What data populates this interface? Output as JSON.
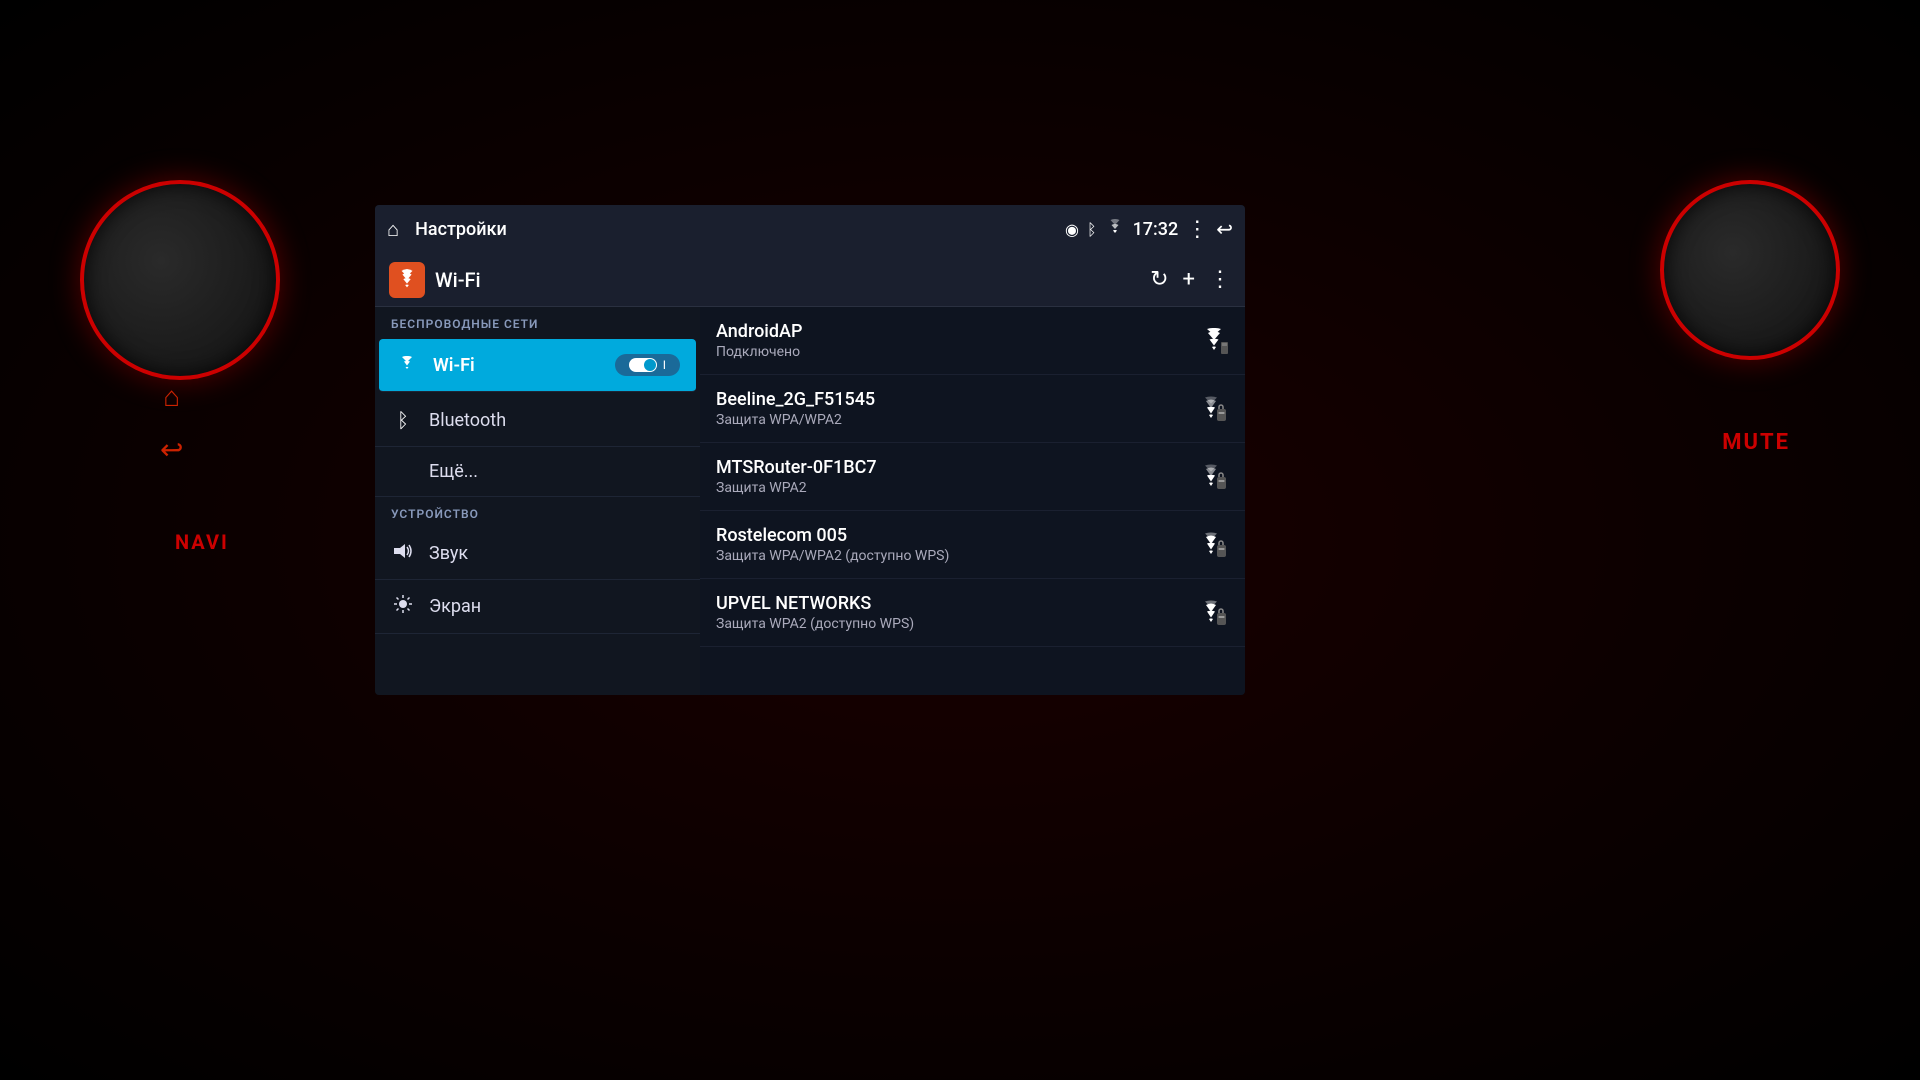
{
  "dashboard": {
    "mute_label": "MUTE",
    "navi_label": "NAVI"
  },
  "statusbar": {
    "title": "Настройки",
    "time": "17:32",
    "home_icon": "⌂",
    "back_icon": "↩",
    "more_icon": "⋮",
    "location_icon": "◉",
    "bluetooth_icon": "ᛒ",
    "wifi_icon": "▲"
  },
  "wifi_header": {
    "label": "Wi-Fi",
    "icon": "✕",
    "refresh_icon": "↻",
    "add_icon": "+",
    "more_icon": "⋮"
  },
  "sidebar": {
    "wireless_section": "БЕСПРОВОДНЫЕ СЕТИ",
    "device_section": "УСТРОЙСТВО",
    "items": [
      {
        "id": "wifi",
        "label": "Wi-Fi",
        "icon": "▲",
        "active": true
      },
      {
        "id": "bluetooth",
        "label": "Bluetooth",
        "icon": "ᛒ",
        "active": false
      },
      {
        "id": "more",
        "label": "Ещё...",
        "icon": "",
        "active": false
      },
      {
        "id": "sound",
        "label": "Звук",
        "icon": "◀))",
        "active": false
      },
      {
        "id": "display",
        "label": "Экран",
        "icon": "✿",
        "active": false
      }
    ]
  },
  "networks": [
    {
      "id": "androidap",
      "name": "AndroidAP",
      "status": "Подключено",
      "secured": false,
      "connected": true
    },
    {
      "id": "beeline",
      "name": "Beeline_2G_F51545",
      "status": "Защита WPA/WPA2",
      "secured": true,
      "connected": false
    },
    {
      "id": "mtsrouter",
      "name": "MTSRouter-0F1BC7",
      "status": "Защита WPA2",
      "secured": true,
      "connected": false
    },
    {
      "id": "rostelecom",
      "name": "Rostelecom 005",
      "status": "Защита WPA/WPA2 (доступно WPS)",
      "secured": true,
      "connected": false
    },
    {
      "id": "upvel",
      "name": "UPVEL NETWORKS",
      "status": "Защита WPA2 (доступно WPS)",
      "secured": true,
      "connected": false
    }
  ]
}
